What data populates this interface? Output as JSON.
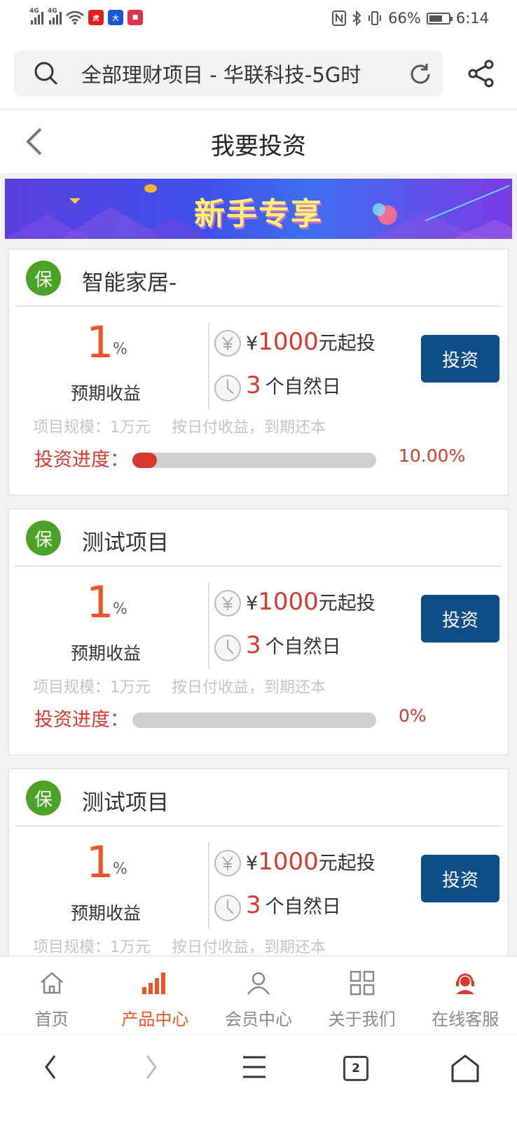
{
  "status_bar": {
    "network_1": "4G",
    "network_2": "4G",
    "battery": "66%",
    "time": "6:14",
    "app_icons": [
      {
        "name": "hupu-app-icon",
        "color": "#e02020",
        "label": "虎"
      },
      {
        "name": "news-app-icon",
        "color": "#1a56d6",
        "label": "大"
      },
      {
        "name": "video-app-icon",
        "color": "#e2334c",
        "label": "■"
      }
    ]
  },
  "browser": {
    "address_text": "全部理财项目 - 华联科技-5G时"
  },
  "page": {
    "title": "我要投资"
  },
  "banner": {
    "text": "新手专享"
  },
  "products": [
    {
      "badge": "保",
      "title": "智能家居-",
      "rate": "1",
      "rate_unit": "%",
      "rate_label": "预期收益",
      "min_prefix": "¥",
      "min_amount": "1000",
      "min_suffix": "元起投",
      "term_days": "3",
      "term_suffix": "个自然日",
      "invest_label": "投资",
      "scale": "项目规模：1万元",
      "repayment": "按日付收益，到期还本",
      "progress_label": "投资进度：",
      "progress_text": "10.00%",
      "progress": 0.1
    },
    {
      "badge": "保",
      "title": "测试项目",
      "rate": "1",
      "rate_unit": "%",
      "rate_label": "预期收益",
      "min_prefix": "¥",
      "min_amount": "1000",
      "min_suffix": "元起投",
      "term_days": "3",
      "term_suffix": "个自然日",
      "invest_label": "投资",
      "scale": "项目规模：1万元",
      "repayment": "按日付收益，到期还本",
      "progress_label": "投资进度：",
      "progress_text": "0%",
      "progress": 0.0
    },
    {
      "badge": "保",
      "title": "测试项目",
      "rate": "1",
      "rate_unit": "%",
      "rate_label": "预期收益",
      "min_prefix": "¥",
      "min_amount": "1000",
      "min_suffix": "元起投",
      "term_days": "3",
      "term_suffix": "个自然日",
      "invest_label": "投资",
      "scale": "项目规模：1万元",
      "repayment": "按日付收益，到期还本"
    }
  ],
  "tabbar": {
    "items": [
      {
        "label": "首页",
        "icon": "home-icon"
      },
      {
        "label": "产品中心",
        "icon": "bar-chart-icon",
        "active": true
      },
      {
        "label": "会员中心",
        "icon": "user-icon"
      },
      {
        "label": "关于我们",
        "icon": "grid-icon"
      },
      {
        "label": "在线客服",
        "icon": "support-agent-icon"
      }
    ]
  },
  "system_nav": {
    "tab_count": "2"
  },
  "colors": {
    "accent_orange": "#ee5426",
    "accent_red": "#d63a2f",
    "invest_button": "#0d4e88",
    "badge_green": "#4aa324"
  }
}
